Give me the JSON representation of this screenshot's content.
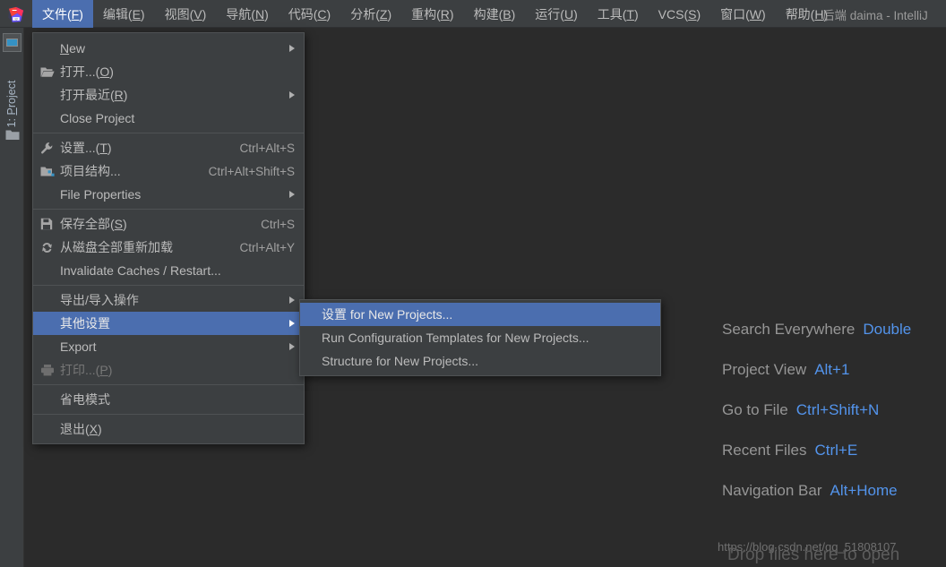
{
  "window": {
    "title": "后端 daima - IntelliJ",
    "logo_icon": "intellij-idea-logo"
  },
  "menubar": {
    "items": [
      {
        "label": "文件(F)",
        "mnemonic": "F",
        "active": true
      },
      {
        "label": "编辑(E)",
        "mnemonic": "E",
        "active": false
      },
      {
        "label": "视图(V)",
        "mnemonic": "V",
        "active": false
      },
      {
        "label": "导航(N)",
        "mnemonic": "N",
        "active": false
      },
      {
        "label": "代码(C)",
        "mnemonic": "C",
        "active": false
      },
      {
        "label": "分析(Z)",
        "mnemonic": "Z",
        "active": false
      },
      {
        "label": "重构(R)",
        "mnemonic": "R",
        "active": false
      },
      {
        "label": "构建(B)",
        "mnemonic": "B",
        "active": false
      },
      {
        "label": "运行(U)",
        "mnemonic": "U",
        "active": false
      },
      {
        "label": "工具(T)",
        "mnemonic": "T",
        "active": false
      },
      {
        "label": "VCS(S)",
        "mnemonic": "S",
        "active": false
      },
      {
        "label": "窗口(W)",
        "mnemonic": "W",
        "active": false
      },
      {
        "label": "帮助(H)",
        "mnemonic": "H",
        "active": false
      }
    ]
  },
  "sidebar": {
    "tab_button_icon": "project-tool-window-icon",
    "project_tab_label": "1: Project",
    "folder_icon": "folder-icon"
  },
  "file_menu": {
    "items": [
      {
        "label": "New",
        "icon": "",
        "accel": "",
        "arrow": true,
        "sep_after": false,
        "disabled": false,
        "selected": false
      },
      {
        "label": "打开...(O)",
        "icon": "folder-open-icon",
        "accel": "",
        "arrow": false,
        "sep_after": false,
        "disabled": false,
        "selected": false
      },
      {
        "label": "打开最近(R)",
        "icon": "",
        "accel": "",
        "arrow": true,
        "sep_after": false,
        "disabled": false,
        "selected": false
      },
      {
        "label": "Close Project",
        "icon": "",
        "accel": "",
        "arrow": false,
        "sep_after": true,
        "disabled": false,
        "selected": false
      },
      {
        "label": "设置...(T)",
        "icon": "wrench-icon",
        "accel": "Ctrl+Alt+S",
        "arrow": false,
        "sep_after": false,
        "disabled": false,
        "selected": false
      },
      {
        "label": "项目结构...",
        "icon": "project-structure-icon",
        "accel": "Ctrl+Alt+Shift+S",
        "arrow": false,
        "sep_after": false,
        "disabled": false,
        "selected": false
      },
      {
        "label": "File Properties",
        "icon": "",
        "accel": "",
        "arrow": true,
        "sep_after": true,
        "disabled": false,
        "selected": false
      },
      {
        "label": "保存全部(S)",
        "icon": "save-icon",
        "accel": "Ctrl+S",
        "arrow": false,
        "sep_after": false,
        "disabled": false,
        "selected": false
      },
      {
        "label": "从磁盘全部重新加载",
        "icon": "reload-icon",
        "accel": "Ctrl+Alt+Y",
        "arrow": false,
        "sep_after": false,
        "disabled": false,
        "selected": false
      },
      {
        "label": "Invalidate Caches / Restart...",
        "icon": "",
        "accel": "",
        "arrow": false,
        "sep_after": true,
        "disabled": false,
        "selected": false
      },
      {
        "label": "导出/导入操作",
        "icon": "",
        "accel": "",
        "arrow": true,
        "sep_after": false,
        "disabled": false,
        "selected": false
      },
      {
        "label": "其他设置",
        "icon": "",
        "accel": "",
        "arrow": true,
        "sep_after": false,
        "disabled": false,
        "selected": true
      },
      {
        "label": "Export",
        "icon": "",
        "accel": "",
        "arrow": true,
        "sep_after": false,
        "disabled": false,
        "selected": false
      },
      {
        "label": "打印...(P)",
        "icon": "printer-icon",
        "accel": "",
        "arrow": false,
        "sep_after": true,
        "disabled": true,
        "selected": false
      },
      {
        "label": "省电模式",
        "icon": "",
        "accel": "",
        "arrow": false,
        "sep_after": true,
        "disabled": false,
        "selected": false
      },
      {
        "label": "退出(X)",
        "icon": "",
        "accel": "",
        "arrow": false,
        "sep_after": false,
        "disabled": false,
        "selected": false
      }
    ]
  },
  "other_settings_submenu": {
    "items": [
      {
        "label": "设置 for New Projects...",
        "selected": true
      },
      {
        "label": "Run Configuration Templates for New Projects...",
        "selected": false
      },
      {
        "label": "Structure for New Projects...",
        "selected": false
      }
    ]
  },
  "hints": {
    "rows": [
      {
        "label": "Search Everywhere",
        "key": "Double"
      },
      {
        "label": "Project View",
        "key": "Alt+1"
      },
      {
        "label": "Go to File",
        "key": "Ctrl+Shift+N"
      },
      {
        "label": "Recent Files",
        "key": "Ctrl+E"
      },
      {
        "label": "Navigation Bar",
        "key": "Alt+Home"
      }
    ],
    "drop_text": "Drop files here to open",
    "watermark": "https://blog.csdn.net/qq_51808107"
  },
  "colors": {
    "background": "#2b2b2b",
    "panel": "#3c3f41",
    "selection": "#4b6eaf",
    "accent_link": "#5394ec",
    "text": "#bbbbbb",
    "text_dim": "#969696"
  }
}
